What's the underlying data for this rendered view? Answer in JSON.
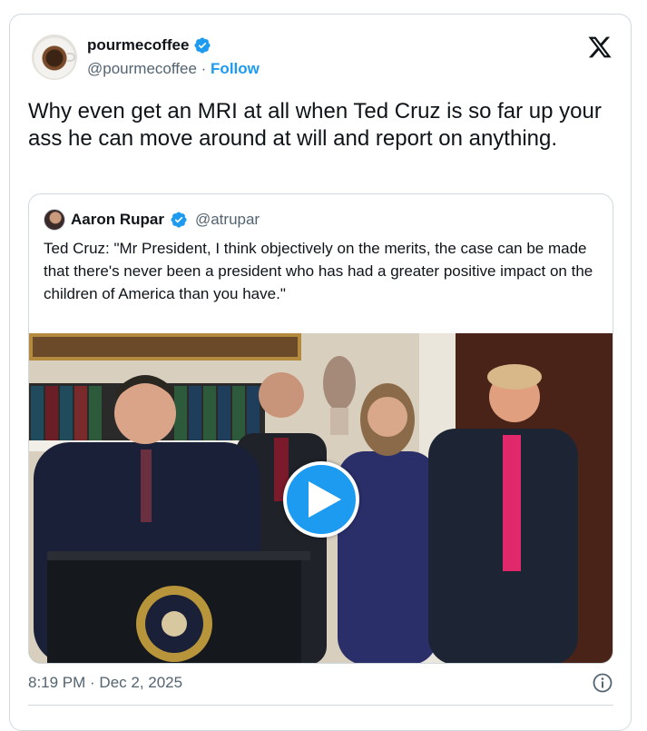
{
  "author": {
    "display_name": "pourmecoffee",
    "handle": "@pourmecoffee",
    "separator": "·",
    "follow_label": "Follow",
    "verified": true,
    "avatar_icon": "coffee-cup-avatar"
  },
  "platform_icon": "x-logo-icon",
  "tweet": {
    "text": "Why even get an MRI at all when Ted Cruz is so far up your ass he can move around at will and report on anything."
  },
  "quoted_tweet": {
    "display_name": "Aaron Rupar",
    "handle": "@atrupar",
    "verified": true,
    "text": "Ted Cruz: \"Mr President, I think objectively on the merits, the case can be made that there's never been a president who has had a greater positive impact on the children of America than you have.\"",
    "media": {
      "type": "video",
      "play_icon": "play-icon"
    }
  },
  "footer": {
    "timestamp": "8:19 PM · Dec 2, 2025",
    "info_icon": "info-icon"
  },
  "colors": {
    "accent": "#1d9bf0",
    "text": "#0f1419",
    "secondary": "#536471",
    "border": "#cfd9de"
  }
}
